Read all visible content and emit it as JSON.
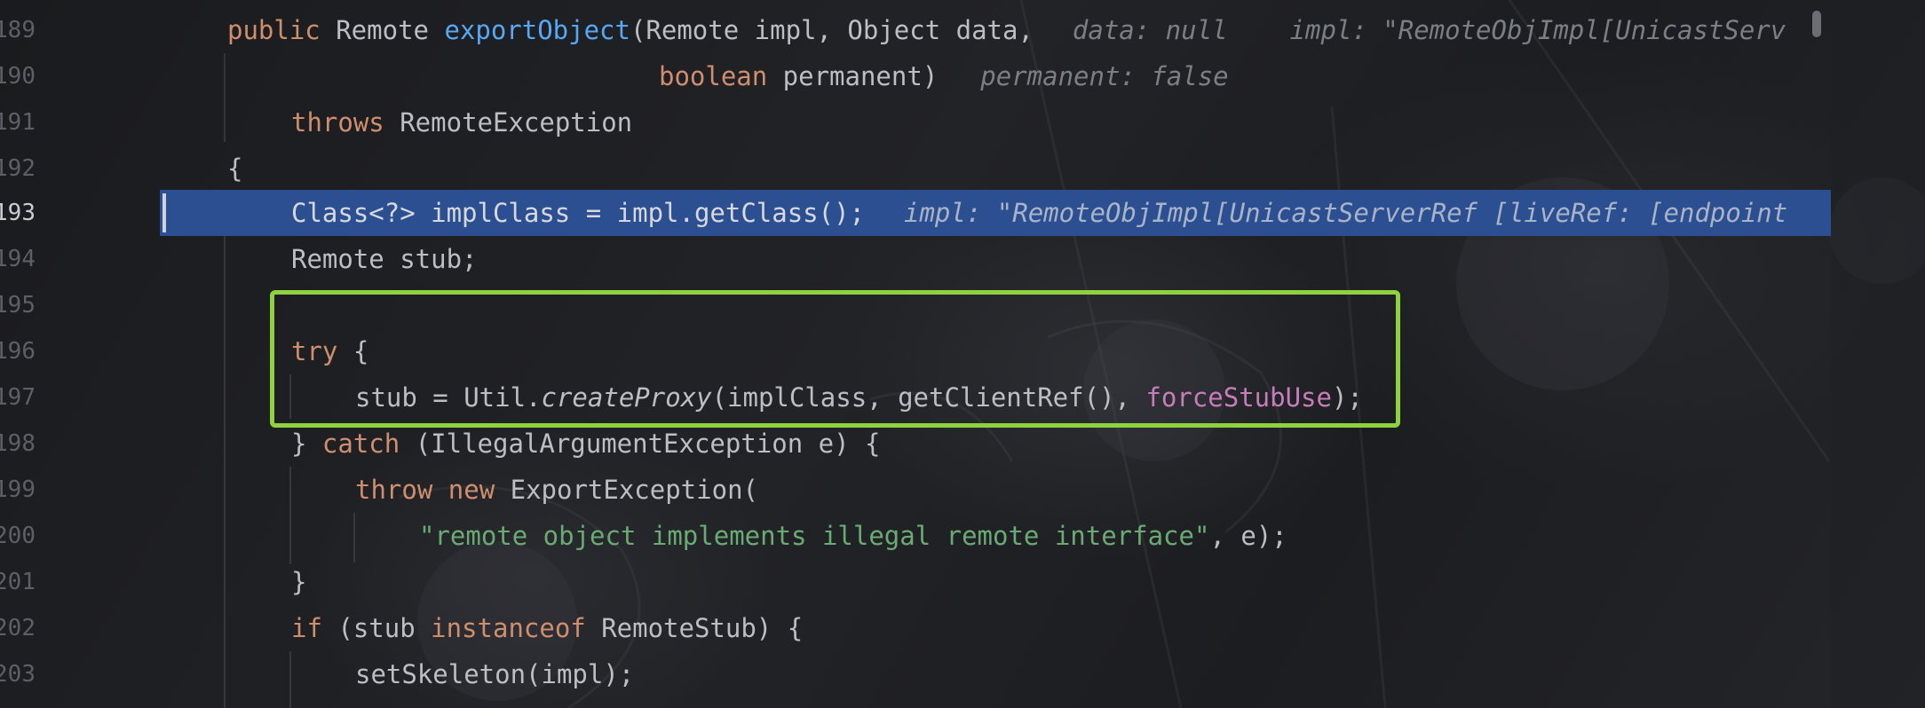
{
  "editor": {
    "line_numbers": [
      "189",
      "190",
      "191",
      "192",
      "193",
      "194",
      "195",
      "196",
      "197",
      "198",
      "199",
      "200",
      "201",
      "202",
      "203"
    ],
    "active_line": "193",
    "lines": {
      "l189": {
        "kw_public": "public",
        "type_remote": " Remote ",
        "method_name": "exportObject",
        "params": "(Remote impl, Object data,",
        "hint1": "data: null",
        "hint2": "impl: \"RemoteObjImpl[UnicastServ"
      },
      "l190": {
        "kw_boolean": "boolean",
        "rest": " permanent)",
        "hint": "permanent: false"
      },
      "l191": {
        "kw_throws": "throws",
        "rest": " RemoteException"
      },
      "l192": {
        "text": "{"
      },
      "l193": {
        "code": "Class<?> implClass = impl.getClass();",
        "hint": "impl: \"RemoteObjImpl[UnicastServerRef [liveRef: [endpoint"
      },
      "l194": {
        "text": "Remote stub;"
      },
      "l196": {
        "kw_try": "try",
        "rest": " {"
      },
      "l197": {
        "part1": "stub = Util.",
        "method": "createProxy",
        "part2": "(implClass, getClientRef(), ",
        "field": "forceStubUse",
        "part3": ");"
      },
      "l198": {
        "part1": "} ",
        "kw_catch": "catch",
        "part2": " (IllegalArgumentException e) {"
      },
      "l199": {
        "kw_throw": "throw",
        "sp": " ",
        "kw_new": "new",
        "rest": " ExportException("
      },
      "l200": {
        "str": "\"remote object implements illegal remote interface\"",
        "rest": ", e);"
      },
      "l201": {
        "text": "}"
      },
      "l202": {
        "kw_if": "if",
        "part1": " (stub ",
        "kw_instanceof": "instanceof",
        "part2": " RemoteStub) {"
      },
      "l203": {
        "text": "setSkeleton(impl);"
      }
    }
  },
  "colors": {
    "background": "#1b1c1f",
    "keyword": "#cf8e6d",
    "method_decl": "#56a8f5",
    "string": "#6aab73",
    "field": "#c77dbb",
    "plain": "#bcbec4",
    "inlay_hint": "#7a7e85",
    "selection_row": "#2c4f91",
    "focus_box": "#8fd13e"
  }
}
